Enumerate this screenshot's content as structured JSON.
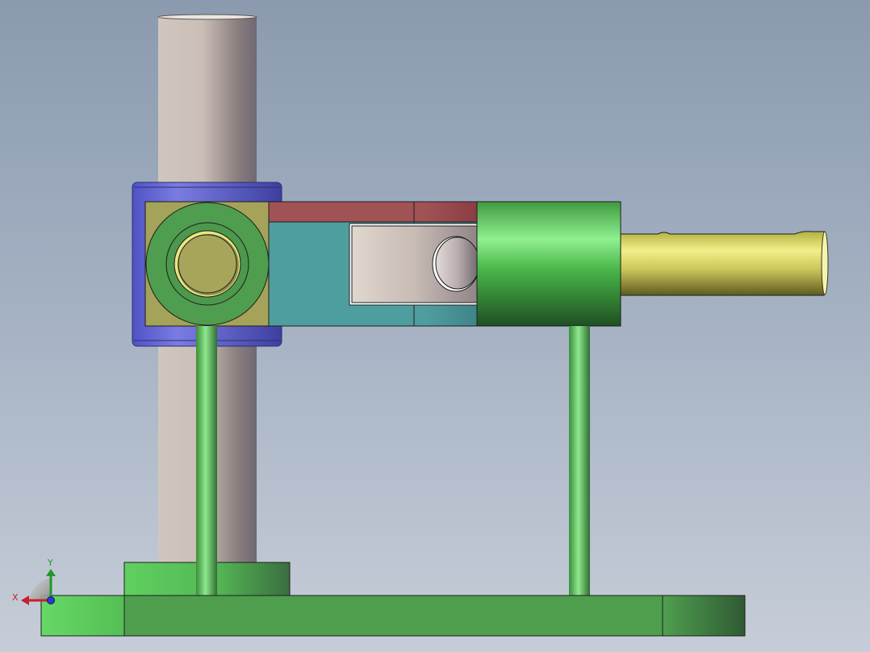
{
  "viewport": {
    "view": "front",
    "background_top": "#8b9aaf",
    "background_bottom": "#c6cdd8"
  },
  "model": {
    "parts": [
      {
        "name": "vertical-column",
        "color": "#c8bdb6"
      },
      {
        "name": "column-clamp-collar",
        "color": "#6f72d8"
      },
      {
        "name": "clamp-block",
        "color": "#a5a359"
      },
      {
        "name": "bearing-ring",
        "color": "#4e9a4e"
      },
      {
        "name": "arm-body",
        "color": "#4f9e9f"
      },
      {
        "name": "arm-top-strip",
        "color": "#a15255"
      },
      {
        "name": "link-plate",
        "color": "#c9beb7"
      },
      {
        "name": "pivot-pin",
        "color": "#bdb1b1"
      },
      {
        "name": "cylinder-body",
        "color": "#5bd05b"
      },
      {
        "name": "piston-rod",
        "color": "#d9d66e"
      },
      {
        "name": "support-rod-left",
        "color": "#5fc85f"
      },
      {
        "name": "support-rod-right",
        "color": "#5fc85f"
      },
      {
        "name": "column-base-boss",
        "color": "#5cc95c"
      },
      {
        "name": "base-plate",
        "color": "#4e9e4e"
      }
    ]
  },
  "triad": {
    "x_label": "X",
    "y_label": "Y",
    "x_color": "#c8202a",
    "y_color": "#1f9a2a",
    "z_color": "#2a3ad0"
  }
}
